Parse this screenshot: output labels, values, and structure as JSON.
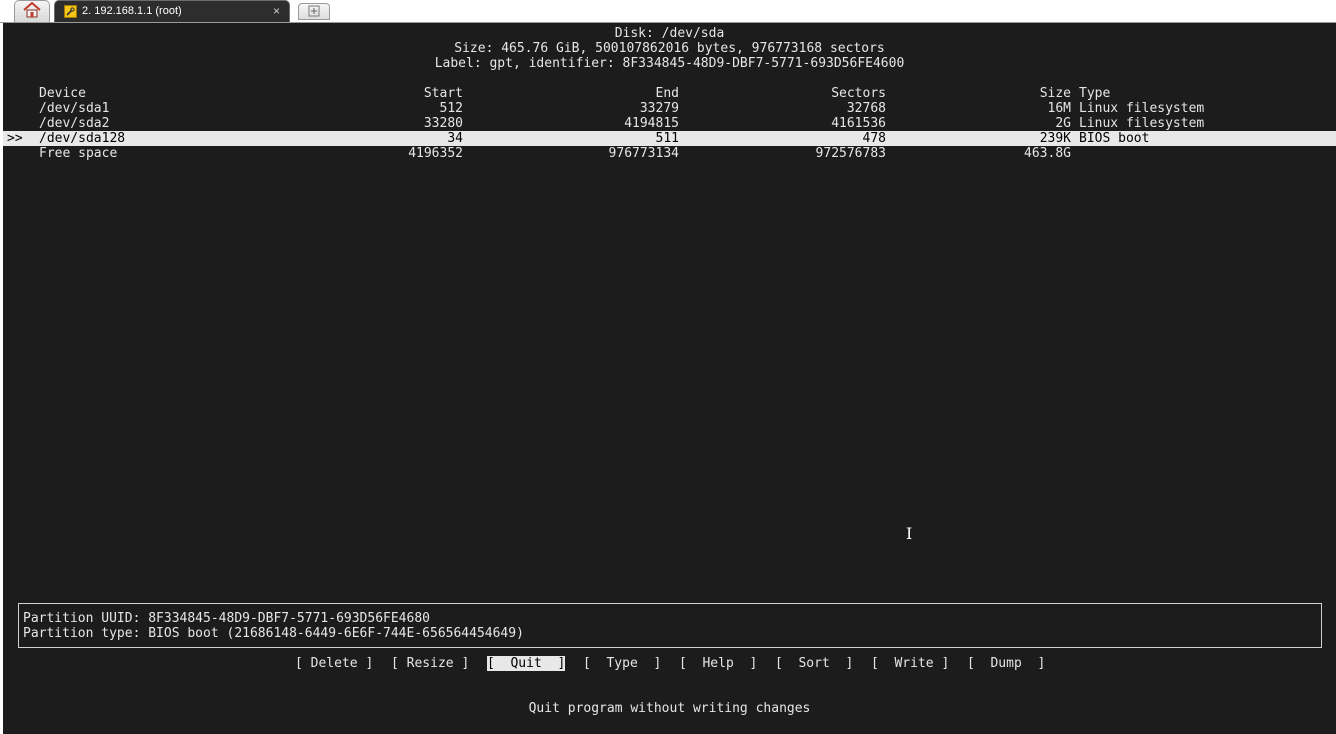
{
  "tabs": {
    "home_icon": "home-icon",
    "session": {
      "icon": "wrench-icon",
      "title": "2. 192.168.1.1 (root)",
      "close": "×"
    },
    "new_tab_icon": "plus-icon"
  },
  "header": {
    "disk": "Disk: /dev/sda",
    "size": "Size: 465.76 GiB, 500107862016 bytes, 976773168 sectors",
    "label": "Label: gpt, identifier: 8F334845-48D9-DBF7-5771-693D56FE4600"
  },
  "table": {
    "columns": {
      "device": "Device",
      "start": "Start",
      "end": "End",
      "sectors": "Sectors",
      "size": "Size",
      "type": "Type"
    },
    "rows": [
      {
        "marker": "",
        "device": "/dev/sda1",
        "start": "512",
        "end": "33279",
        "sectors": "32768",
        "size": "16M",
        "type": "Linux filesystem"
      },
      {
        "marker": "",
        "device": "/dev/sda2",
        "start": "33280",
        "end": "4194815",
        "sectors": "4161536",
        "size": "2G",
        "type": "Linux filesystem"
      },
      {
        "marker": ">>",
        "device": "/dev/sda128",
        "start": "34",
        "end": "511",
        "sectors": "478",
        "size": "239K",
        "type": "BIOS boot"
      },
      {
        "marker": "",
        "device": "Free space",
        "start": "4196352",
        "end": "976773134",
        "sectors": "972576783",
        "size": "463.8G",
        "type": ""
      }
    ]
  },
  "info": {
    "uuid": "Partition UUID: 8F334845-48D9-DBF7-5771-693D56FE4680",
    "type": "Partition type: BIOS boot (21686148-6449-6E6F-744E-656564454649)"
  },
  "menu": {
    "delete": "[ Delete ]",
    "resize": "[ Resize ]",
    "quit": "[  Quit  ]",
    "type": "[  Type  ]",
    "help": "[  Help  ]",
    "sort": "[  Sort  ]",
    "write": "[  Write ]",
    "dump": "[  Dump  ]"
  },
  "status": "Quit program without writing changes",
  "colors": {
    "terminal_bg": "#1c1c1c",
    "terminal_fg": "#e6e6e6",
    "highlight_bg": "#e8e8e8",
    "tab_active_bg": "#2d2d2d"
  }
}
